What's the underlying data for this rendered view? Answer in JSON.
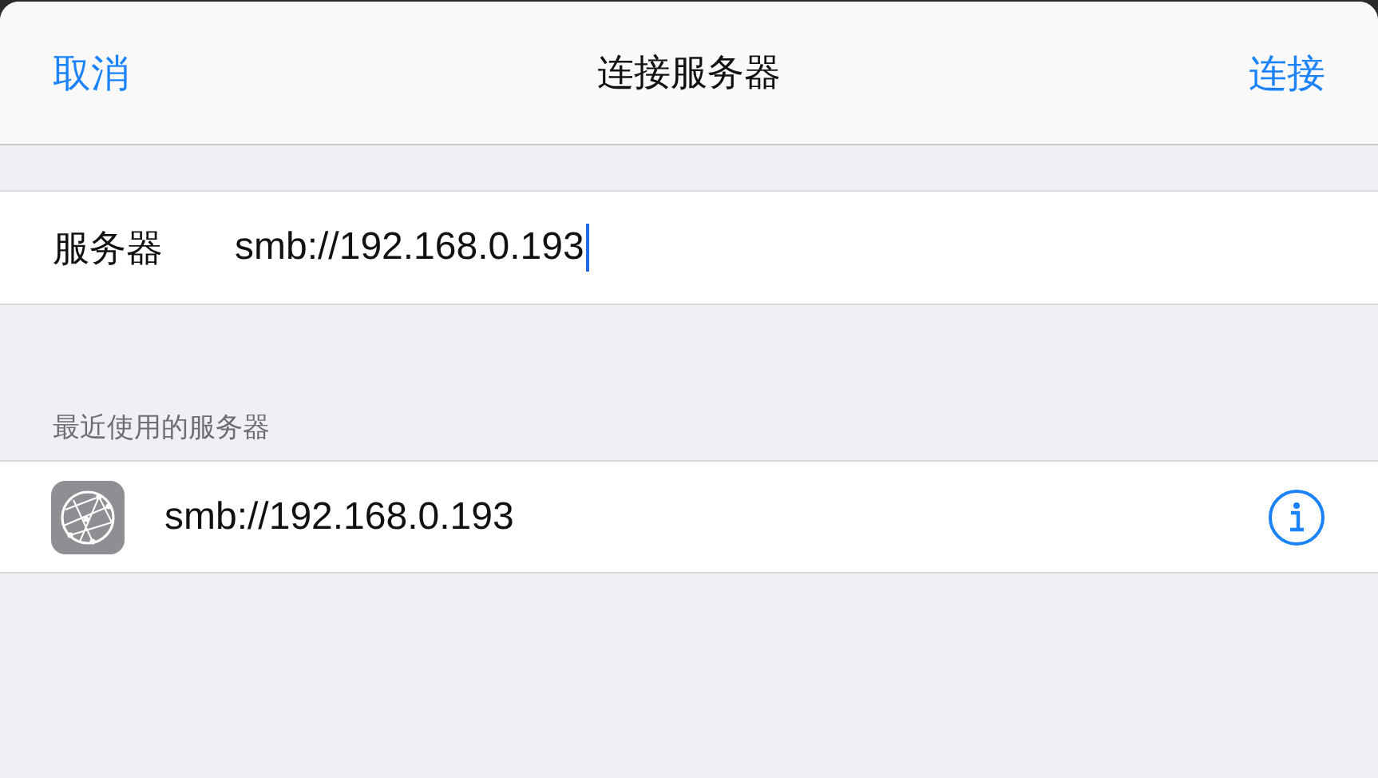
{
  "nav_bar": {
    "cancel": "取消",
    "title": "连接服务器",
    "connect": "连接"
  },
  "server_field": {
    "label": "服务器",
    "value": "smb://192.168.0.193",
    "focused": true
  },
  "recent": {
    "header": "最近使用的服务器",
    "items": [
      {
        "address": "smb://192.168.0.193"
      }
    ]
  }
}
